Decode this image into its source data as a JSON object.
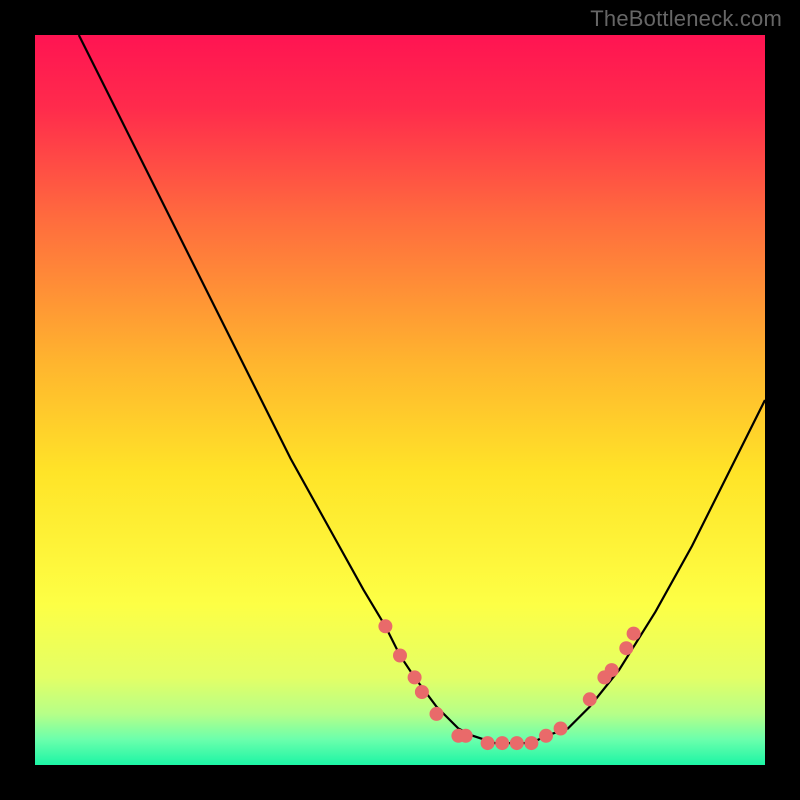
{
  "watermark": "TheBottleneck.com",
  "chart_data": {
    "type": "line",
    "title": "",
    "xlabel": "",
    "ylabel": "",
    "xlim": [
      0,
      100
    ],
    "ylim": [
      0,
      100
    ],
    "grid": false,
    "series": [
      {
        "name": "curve",
        "color": "#000000",
        "x": [
          6,
          10,
          15,
          20,
          25,
          30,
          35,
          40,
          45,
          48,
          50,
          52,
          55,
          58,
          60,
          63,
          65,
          68,
          70,
          73,
          76,
          80,
          85,
          90,
          95,
          100
        ],
        "y": [
          100,
          92,
          82,
          72,
          62,
          52,
          42,
          33,
          24,
          19,
          15,
          12,
          8,
          5,
          4,
          3,
          3,
          3,
          4,
          5,
          8,
          13,
          21,
          30,
          40,
          50
        ]
      }
    ],
    "markers": [
      {
        "x": 48,
        "y": 19,
        "color": "#e96a6a"
      },
      {
        "x": 50,
        "y": 15,
        "color": "#e96a6a"
      },
      {
        "x": 52,
        "y": 12,
        "color": "#e96a6a"
      },
      {
        "x": 53,
        "y": 10,
        "color": "#e96a6a"
      },
      {
        "x": 55,
        "y": 7,
        "color": "#e96a6a"
      },
      {
        "x": 58,
        "y": 4,
        "color": "#e96a6a"
      },
      {
        "x": 59,
        "y": 4,
        "color": "#e96a6a"
      },
      {
        "x": 62,
        "y": 3,
        "color": "#e96a6a"
      },
      {
        "x": 64,
        "y": 3,
        "color": "#e96a6a"
      },
      {
        "x": 66,
        "y": 3,
        "color": "#e96a6a"
      },
      {
        "x": 68,
        "y": 3,
        "color": "#e96a6a"
      },
      {
        "x": 70,
        "y": 4,
        "color": "#e96a6a"
      },
      {
        "x": 72,
        "y": 5,
        "color": "#e96a6a"
      },
      {
        "x": 76,
        "y": 9,
        "color": "#e96a6a"
      },
      {
        "x": 78,
        "y": 12,
        "color": "#e96a6a"
      },
      {
        "x": 79,
        "y": 13,
        "color": "#e96a6a"
      },
      {
        "x": 81,
        "y": 16,
        "color": "#e96a6a"
      },
      {
        "x": 82,
        "y": 18,
        "color": "#e96a6a"
      }
    ],
    "gradient_stops": [
      {
        "offset": 0.0,
        "color": "#ff1452"
      },
      {
        "offset": 0.1,
        "color": "#ff2b4c"
      },
      {
        "offset": 0.25,
        "color": "#ff6b3e"
      },
      {
        "offset": 0.45,
        "color": "#ffb52e"
      },
      {
        "offset": 0.6,
        "color": "#ffe428"
      },
      {
        "offset": 0.78,
        "color": "#fdff45"
      },
      {
        "offset": 0.88,
        "color": "#e3ff66"
      },
      {
        "offset": 0.93,
        "color": "#b6ff88"
      },
      {
        "offset": 0.965,
        "color": "#6bffac"
      },
      {
        "offset": 1.0,
        "color": "#1cf5a5"
      }
    ]
  }
}
